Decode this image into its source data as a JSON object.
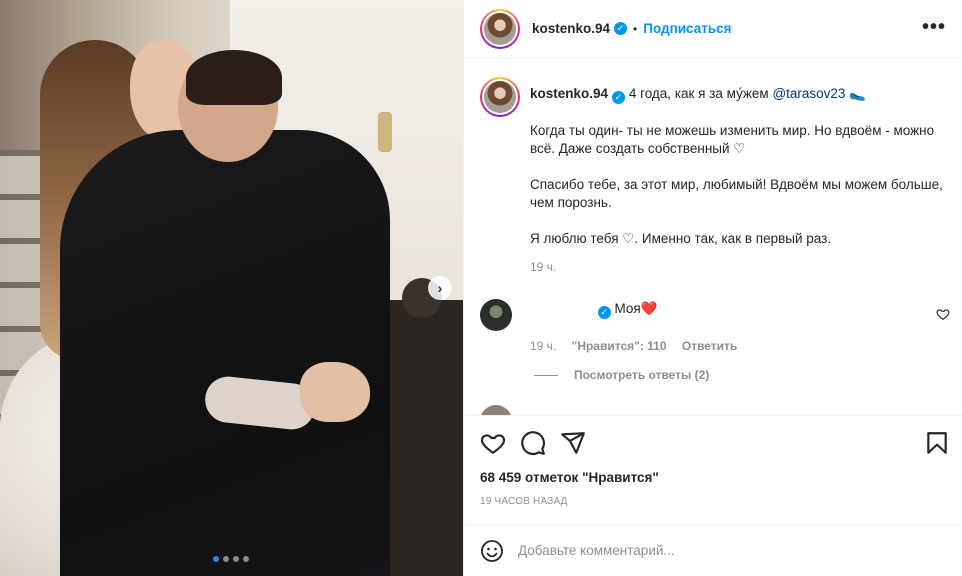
{
  "post": {
    "username": "kostenko.94",
    "follow_label": "Подписаться",
    "separator": "•",
    "more_label": "•••"
  },
  "caption": {
    "username": "kostenko.94",
    "first_line": "4 года, как я за му́жем",
    "mention": "@tarasov23",
    "emoji": "🥿",
    "paragraph1": "Когда ты один- ты не можешь изменить мир. Но вдвоём - можно всё. Даже создать собственный ♡",
    "paragraph2": "Спасибо тебе, за этот мир, любимый! Вдвоём мы можем больше, чем порознь.",
    "paragraph3": "Я люблю тебя ♡. Именно так, как в первый раз.",
    "time": "19 ч."
  },
  "comment": {
    "text": "Моя",
    "heart": "❤️",
    "time": "19 ч.",
    "likes": "\"Нравится\": 110",
    "reply": "Ответить",
    "view_replies": "Посмотреть ответы (2)"
  },
  "likes_count": "68 459 отметок \"Нравится\"",
  "ago": "19 ЧАСОВ НАЗАД",
  "add_comment": {
    "placeholder": "Добавьте комментарий..."
  },
  "carousel": {
    "total": 4,
    "active": 1
  },
  "colors": {
    "accent": "#0095f6",
    "mention": "#00376b",
    "muted": "#8e8e8e",
    "active_dot": "#1a8bf2",
    "heart_red": "#ed4956"
  },
  "icons": [
    "next-arrow-icon",
    "verified-icon",
    "more-icon",
    "heart-icon",
    "comment-icon",
    "share-icon",
    "bookmark-icon",
    "emoji-icon"
  ]
}
